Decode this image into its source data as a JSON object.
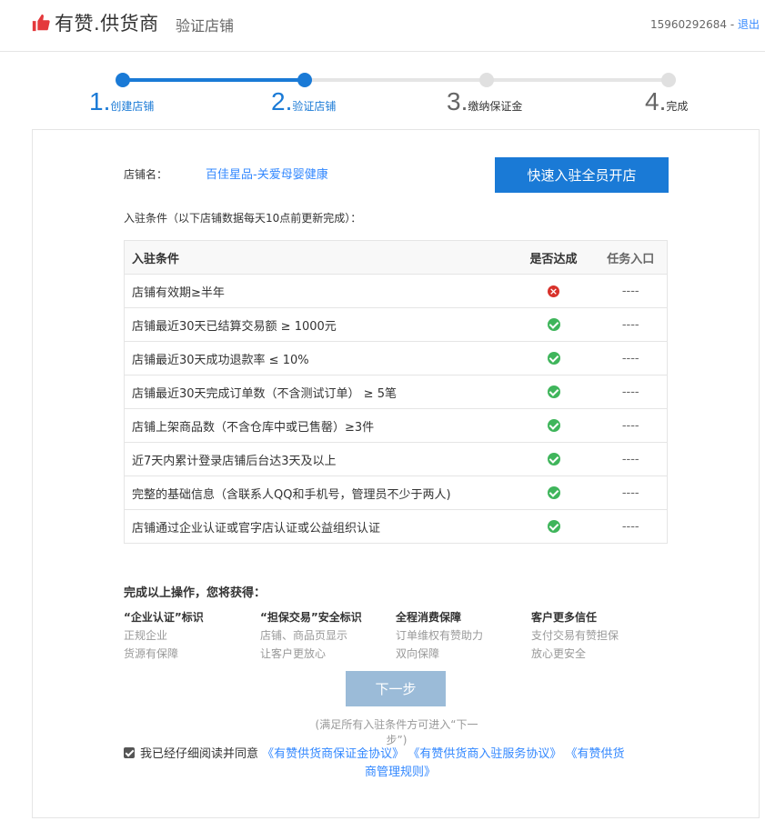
{
  "header": {
    "brand": "有赞.供货商",
    "subtitle": "验证店铺",
    "phone": "15960292684",
    "separator": "-",
    "logout": "退出"
  },
  "steps": [
    {
      "num": "1.",
      "label": "创建店铺",
      "state": "done"
    },
    {
      "num": "2.",
      "label": "验证店铺",
      "state": "done"
    },
    {
      "num": "3.",
      "label": "缴纳保证金",
      "state": "todo"
    },
    {
      "num": "4.",
      "label": "完成",
      "state": "todo"
    }
  ],
  "shop": {
    "label": "店铺名：",
    "name": "百佳星品-关爱母婴健康",
    "vip_button": "快速入驻全员开店"
  },
  "conditions": {
    "intro": "入驻条件（以下店铺数据每天10点前更新完成）：",
    "headers": [
      "入驻条件",
      "是否达成",
      "任务入口"
    ],
    "rows": [
      {
        "text": "店铺有效期≥半年",
        "met": false,
        "entry": "----"
      },
      {
        "text": "店铺最近30天已结算交易额 ≥ 1000元",
        "met": true,
        "entry": "----"
      },
      {
        "text": "店铺最近30天成功退款率 ≤ 10%",
        "met": true,
        "entry": "----"
      },
      {
        "text": "店铺最近30天完成订单数（不含测试订单） ≥ 5笔",
        "met": true,
        "entry": "----"
      },
      {
        "text": "店铺上架商品数（不含仓库中或已售罄）≥3件",
        "met": true,
        "entry": "----"
      },
      {
        "text": "近7天内累计登录店铺后台达3天及以上",
        "met": true,
        "entry": "----"
      },
      {
        "text": "完整的基础信息（含联系人QQ和手机号，管理员不少于两人)",
        "met": true,
        "entry": "----"
      },
      {
        "text": "店铺通过企业认证或官字店认证或公益组织认证",
        "met": true,
        "entry": "----"
      }
    ]
  },
  "benefits": {
    "title": "完成以上操作，您将获得：",
    "items": [
      {
        "title": "“企业认证”标识",
        "lines": [
          "正规企业",
          "货源有保障"
        ]
      },
      {
        "title": "“担保交易”安全标识",
        "lines": [
          "店铺、商品页显示",
          "让客户更放心"
        ]
      },
      {
        "title": "全程消费保障",
        "lines": [
          "订单维权有赞助力",
          "双向保障"
        ]
      },
      {
        "title": "客户更多信任",
        "lines": [
          "支付交易有赞担保",
          "放心更安全"
        ]
      }
    ]
  },
  "next": {
    "label": "下一步",
    "tip": "(满足所有入驻条件方可进入“下一步”)"
  },
  "agreement": {
    "text": "我已经仔细阅读并同意",
    "links": [
      "《有赞供货商保证金协议》",
      "《有赞供货商入驻服务协议》",
      "《有赞供货",
      "商管理规则》"
    ],
    "checked": true
  },
  "colors": {
    "primary": "#1a7ad6",
    "link": "#3388ff",
    "success": "#3fb55b",
    "error": "#d8322b",
    "brand_red": "#e4393c"
  }
}
